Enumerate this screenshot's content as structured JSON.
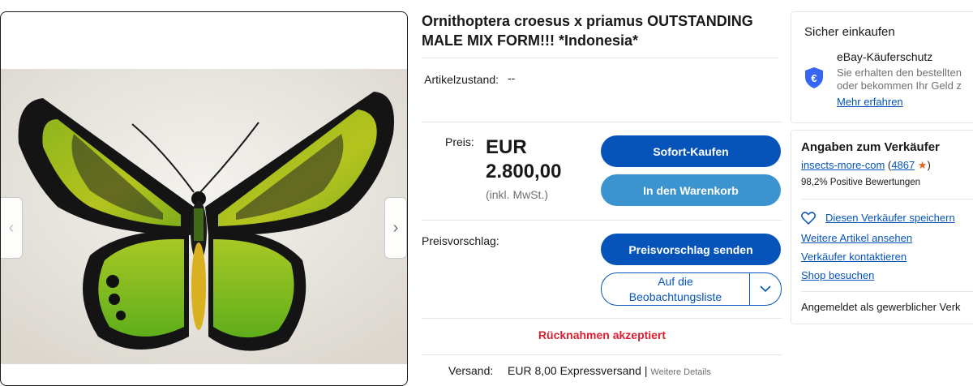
{
  "gallery": {
    "prev_icon": "chevron-left-icon",
    "next_icon": "chevron-right-icon",
    "image_subject": "butterfly-photo"
  },
  "listing": {
    "title": "Ornithoptera croesus x priamus OUTSTANDING MALE MIX FORM!!! *Indonesia*",
    "condition_label": "Artikelzustand:",
    "condition_value": "--",
    "price_label": "Preis:",
    "price_currency": "EUR",
    "price_value": "2.800,00",
    "price_note": "(inkl. MwSt.)",
    "buy_now": "Sofort-Kaufen",
    "add_to_cart": "In den Warenkorb",
    "offer_label": "Preisvorschlag:",
    "offer_button": "Preisvorschlag senden",
    "watch_line1": "Auf die",
    "watch_line2": "Beobachtungsliste",
    "returns": "Rücknahmen akzeptiert",
    "shipping_label": "Versand:",
    "shipping_value": "EUR 8,00 Expressversand",
    "shipping_sep": " | ",
    "shipping_more": "Weitere Details"
  },
  "buyer_protection": {
    "heading": "Sicher einkaufen",
    "title": "eBay-Käuferschutz",
    "line1": "Sie erhalten den bestellten",
    "line2": "oder bekommen Ihr Geld z",
    "link": "Mehr erfahren",
    "icon": "euro-shield-icon"
  },
  "seller": {
    "heading": "Angaben zum Verkäufer",
    "name": "insects-more-com",
    "paren_open": " (",
    "rating_count": "4867",
    "paren_close": ")",
    "positive": "98,2% Positive Bewertungen",
    "save": "Diesen Verkäufer speichern",
    "more_items": "Weitere Artikel ansehen",
    "contact": "Verkäufer kontaktieren",
    "shop": "Shop besuchen",
    "footer": "Angemeldet als gewerblicher Verk"
  },
  "colors": {
    "primary": "#0654ba",
    "secondary": "#3b93cf",
    "returns": "#dd1e31",
    "star": "#e0641b"
  }
}
